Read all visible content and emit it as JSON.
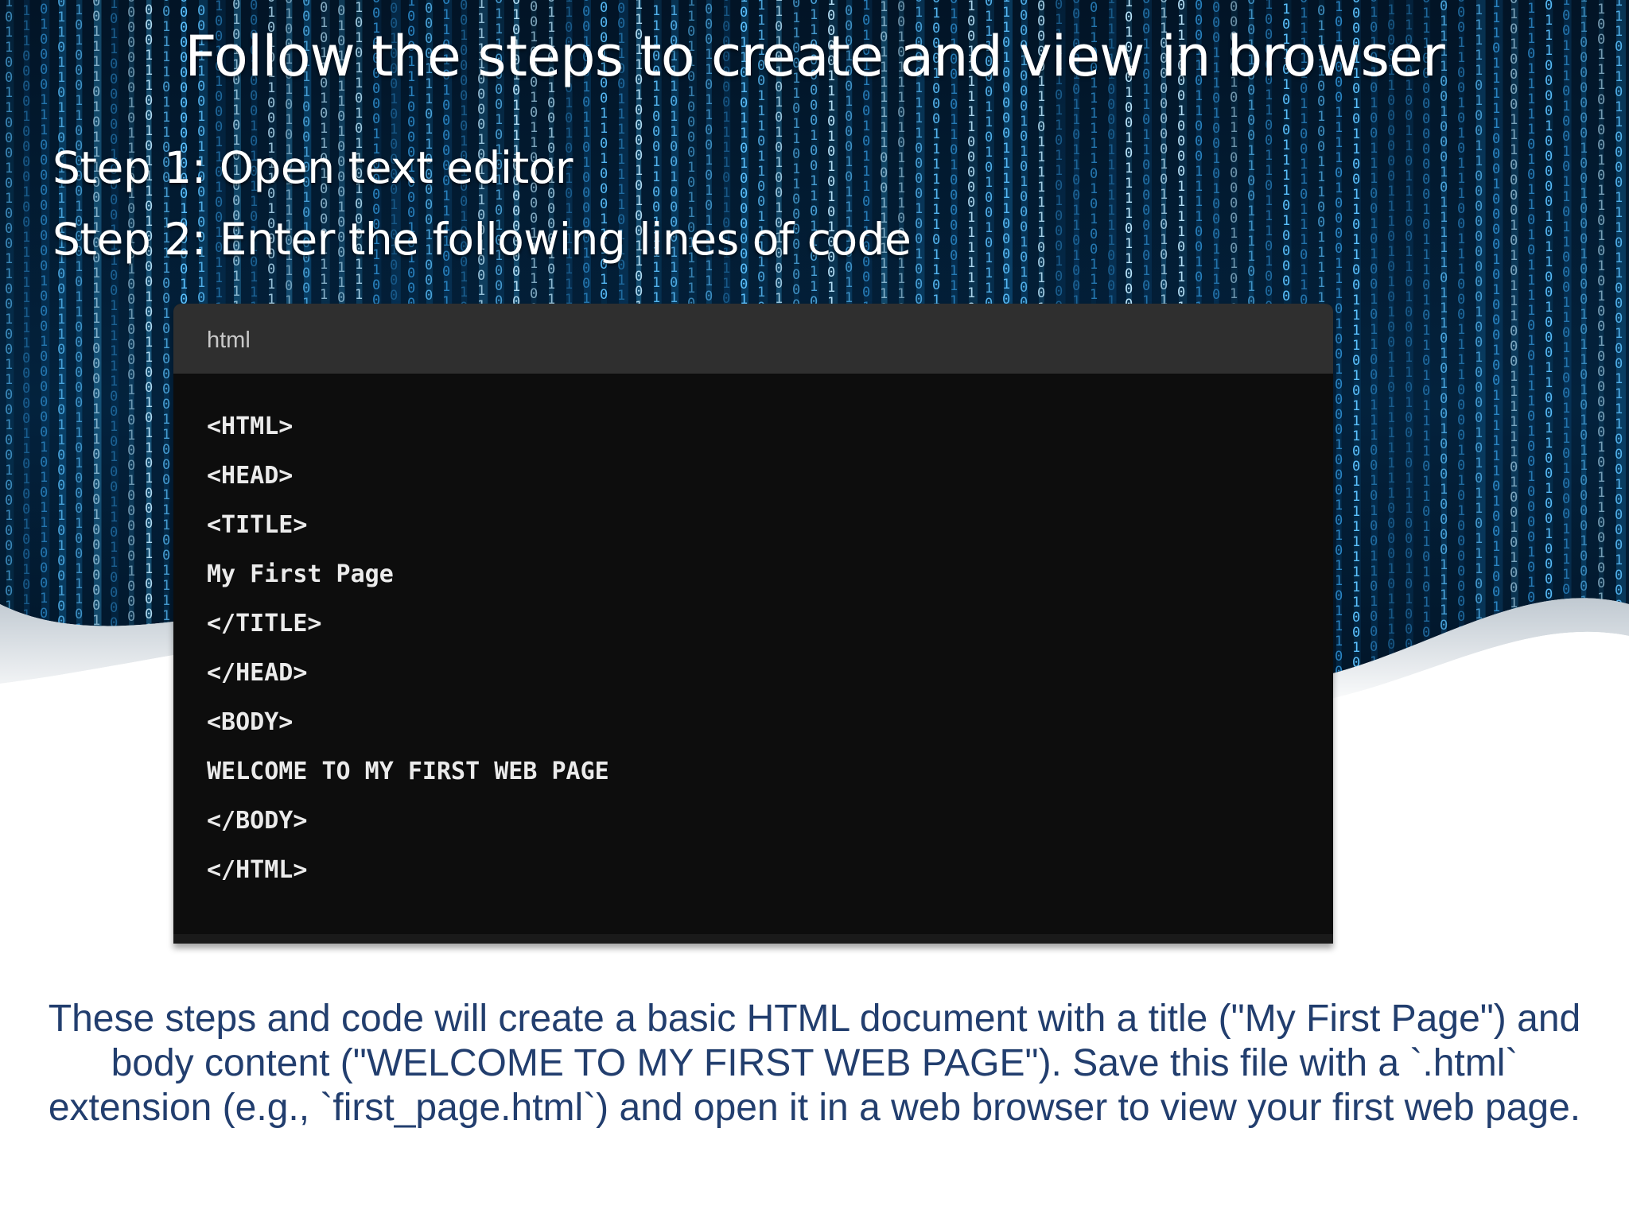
{
  "slide": {
    "title": "Follow the steps to create and view in browser",
    "steps": [
      "Step 1: Open text editor",
      "Step 2: Enter the following lines of code"
    ],
    "code_block": {
      "language": "html",
      "lines": [
        "<HTML>",
        "<HEAD>",
        "<TITLE>",
        "My First Page",
        "</TITLE>",
        "</HEAD>",
        "<BODY>",
        "WELCOME TO MY FIRST WEB PAGE",
        "</BODY>",
        "</HTML>"
      ]
    },
    "caption": "These steps and code will create a basic HTML document with a title (\"My First Page\") and body content (\"WELCOME TO MY FIRST WEB PAGE\"). Save this file with a `.html` extension (e.g., `first_page.html`) and open it in a web browser to view your first web page."
  },
  "colors": {
    "banner_dark": "#001529",
    "banner_glow": "#1aa3ff",
    "code_bg": "#0d0d0d",
    "code_header": "#2f2f2f",
    "caption_text": "#223e6e"
  },
  "icons": [
    "binary-rain-background"
  ]
}
